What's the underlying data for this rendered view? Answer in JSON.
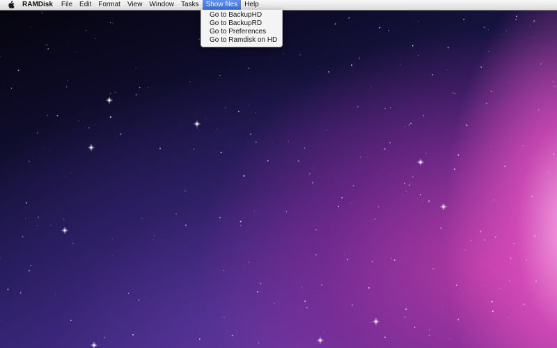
{
  "menubar": {
    "apple_icon": "apple-logo-icon",
    "app_name": "RAMDisk",
    "items": [
      "File",
      "Edit",
      "Format",
      "View",
      "Window",
      "Tasks",
      "Show files",
      "Help"
    ],
    "active_item": "Show files"
  },
  "dropdown": {
    "items": [
      "Go to BackupHD",
      "Go to BackupRD",
      "Go to Preferences",
      "Go to Ramdisk on HD"
    ]
  },
  "colors": {
    "menu_highlight": "#3470e6",
    "desktop_dark": "#0e0c2a",
    "desktop_magenta": "#c83cab"
  }
}
